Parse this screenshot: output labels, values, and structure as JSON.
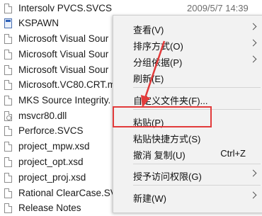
{
  "files": [
    {
      "name": "Intersolv PVCS.SVCS",
      "date": "2009/5/7 14:39",
      "icon": "document-icon"
    },
    {
      "name": "KSPAWN",
      "date": "",
      "icon": "application-icon"
    },
    {
      "name": "Microsoft Visual Sour",
      "date": "",
      "icon": "document-icon"
    },
    {
      "name": "Microsoft Visual Sour",
      "date": "",
      "icon": "document-icon"
    },
    {
      "name": "Microsoft Visual Sour",
      "date": "",
      "icon": "document-icon"
    },
    {
      "name": "Microsoft.VC80.CRT.m",
      "date": "",
      "icon": "document-icon"
    },
    {
      "name": "MKS Source Integrity.",
      "date": "",
      "icon": "document-icon"
    },
    {
      "name": "msvcr80.dll",
      "date": "",
      "icon": "dll-icon"
    },
    {
      "name": "Perforce.SVCS",
      "date": "",
      "icon": "document-icon"
    },
    {
      "name": "project_mpw.xsd",
      "date": "",
      "icon": "document-icon"
    },
    {
      "name": "project_opt.xsd",
      "date": "",
      "icon": "document-icon"
    },
    {
      "name": "project_proj.xsd",
      "date": "",
      "icon": "document-icon"
    },
    {
      "name": "Rational ClearCase.SV",
      "date": "",
      "icon": "document-icon"
    },
    {
      "name": "Release Notes",
      "date": "",
      "icon": "document-icon"
    }
  ],
  "context_menu": {
    "view": "查看(V)",
    "sort_by": "排序方式(O)",
    "group_by": "分组依据(P)",
    "refresh": "刷新(E)",
    "customize_folder": "自定义文件夹(F)...",
    "paste": "粘贴(P)",
    "paste_shortcut": "粘贴快捷方式(S)",
    "undo_copy": "撤消 复制(U)",
    "undo_copy_shortcut": "Ctrl+Z",
    "give_access": "授予访问权限(G)",
    "new": "新建(W)"
  },
  "annotation": {
    "highlight_color": "#e23b3b"
  }
}
